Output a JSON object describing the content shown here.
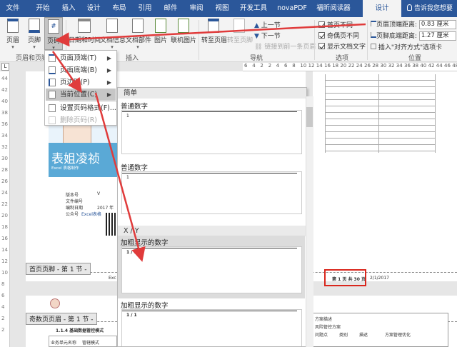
{
  "ribbon": {
    "tabs": [
      "文件",
      "开始",
      "插入",
      "设计",
      "布局",
      "引用",
      "邮件",
      "审阅",
      "视图",
      "开发工具",
      "novaPDF",
      "福昕阅读器",
      "设计"
    ],
    "tell_me": "告诉我您想要",
    "buttons": {
      "header": "页眉",
      "footer": "页脚",
      "page_number": "页码",
      "date_time": "日期和时间",
      "doc_info": "文档信息",
      "doc_parts": "文档部件",
      "picture": "图片",
      "online_picture": "联机图片",
      "goto_header": "转至页眉",
      "goto_footer": "转至页脚"
    },
    "groups": {
      "header_footer": "页眉和页脚",
      "insert": "插入",
      "navigation": "导航",
      "options": "选项",
      "position": "位置"
    },
    "nav": {
      "prev": "上一节",
      "next": "下一节",
      "link_prev": "链接到前一条页眉"
    },
    "options": {
      "first_page_diff": "首页不同",
      "odd_even_diff": "奇偶页不同",
      "show_doc_text": "显示文档文字"
    },
    "position": {
      "header_top_label": "页眉顶端距离:",
      "header_top_value": "0.83 厘米",
      "footer_bottom_label": "页脚底端距离:",
      "footer_bottom_value": "1.27 厘米",
      "insert_align_tab": "插入\"对齐方式\"选项卡"
    }
  },
  "ruler": {
    "h_ticks": [
      "6",
      "4",
      "2",
      "2",
      "4",
      "6",
      "8",
      "10",
      "12",
      "14",
      "16",
      "18",
      "20",
      "22",
      "24",
      "26",
      "28",
      "30",
      "32",
      "34",
      "36",
      "38",
      "40",
      "42",
      "44",
      "46",
      "48"
    ],
    "v_ticks": [
      "44",
      "42",
      "40",
      "38",
      "36",
      "34",
      "32",
      "30",
      "28",
      "26",
      "24",
      "22",
      "20",
      "18",
      "16",
      "14",
      "12",
      "10",
      "8",
      "6",
      "4",
      "2",
      "2"
    ]
  },
  "menu": {
    "items": [
      {
        "label": "页面顶端(T)",
        "state": "normal"
      },
      {
        "label": "页面底端(B)",
        "state": "normal"
      },
      {
        "label": "页边距(P)",
        "state": "normal"
      },
      {
        "label": "当前位置(C)",
        "state": "highlighted"
      },
      {
        "label": "设置页码格式(F)...",
        "state": "normal"
      },
      {
        "label": "删除页码(R)",
        "state": "disabled"
      }
    ]
  },
  "gallery": {
    "section_simple": "简单",
    "section_xy": "X / Y",
    "items": [
      {
        "label": "普通数字",
        "preview": "1"
      },
      {
        "label": "普通数字",
        "preview": "1"
      },
      {
        "label": "加粗显示的数字",
        "preview": "1 / 1"
      },
      {
        "label": "加粗显示的数字",
        "preview": "1 / 1"
      }
    ]
  },
  "document": {
    "first_page_footer_tag": "首页页脚 - 第 1 节 -",
    "odd_page_header_tag": "奇数页页眉 - 第 1 节 -",
    "book_title": "表姐凌祯",
    "book_subtitle": "Excel 表格制作",
    "footer_page_text": "第 1 页  共 30 页",
    "footer_date": "2/1/2017",
    "first_page_footer_left": "Exc",
    "section_heading": "1.1.4   基础数据管控模式",
    "table_headers": [
      "业务单元名称",
      "管辖模式"
    ],
    "info_rows": [
      [
        "版本号",
        "V"
      ],
      [
        "文件编号",
        ""
      ],
      [
        "编制日期",
        "2017 年"
      ],
      [
        "公众号",
        "Excel表格"
      ]
    ],
    "right_table_cells": [
      "方案描述",
      "风险管控方案",
      "问题点",
      "类别",
      "描述",
      "方案管理优化"
    ]
  },
  "highlight": {
    "color": "#d9261c",
    "arrow_color": "#e03b3b"
  }
}
